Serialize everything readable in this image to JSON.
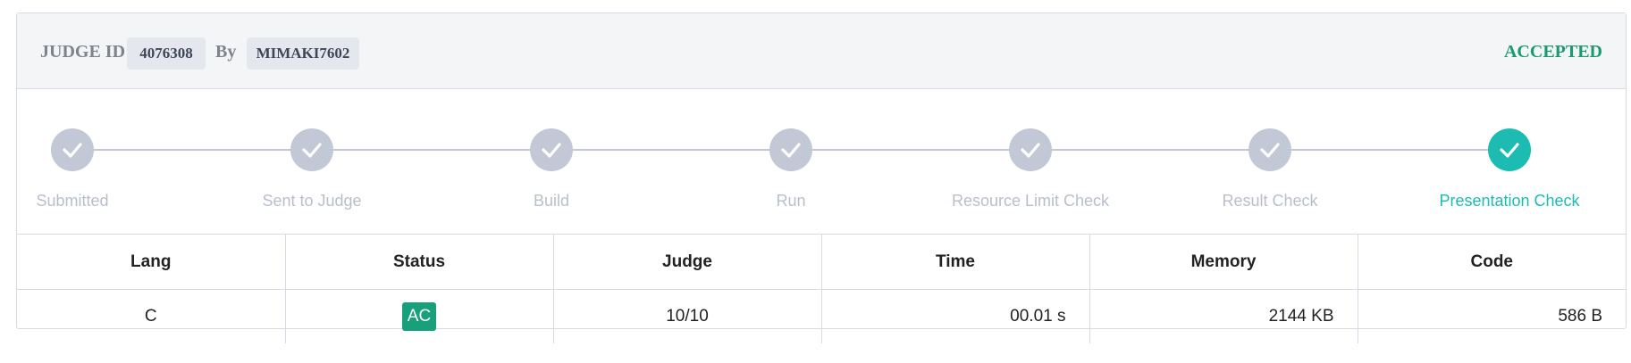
{
  "header": {
    "judge_id_label": "JUDGE ID :",
    "judge_id": "4076308",
    "by_label": "By",
    "user": "MIMAKI7602",
    "status": "ACCEPTED"
  },
  "steps": [
    {
      "label": "Submitted",
      "active": false
    },
    {
      "label": "Sent to Judge",
      "active": false
    },
    {
      "label": "Build",
      "active": false
    },
    {
      "label": "Run",
      "active": false
    },
    {
      "label": "Resource Limit Check",
      "active": false
    },
    {
      "label": "Result Check",
      "active": false
    },
    {
      "label": "Presentation Check",
      "active": true
    }
  ],
  "table": {
    "headers": [
      "Lang",
      "Status",
      "Judge",
      "Time",
      "Memory",
      "Code"
    ],
    "row": {
      "lang": "C",
      "status": "AC",
      "judge": "10/10",
      "time": "00.01 s",
      "memory": "2144 KB",
      "code": "586 B"
    }
  },
  "colors": {
    "accepted": "#1a9a6e",
    "active_step": "#1dbcb3",
    "inactive_step": "#c2c8d6",
    "ac_badge": "#17a07a"
  }
}
